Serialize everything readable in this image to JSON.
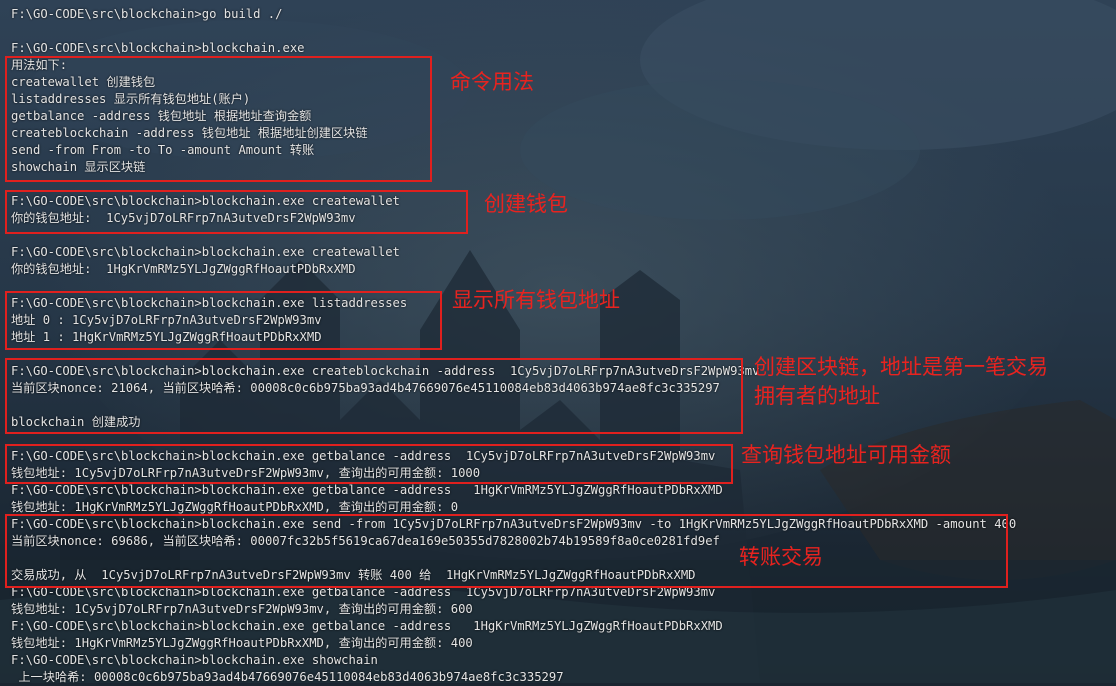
{
  "terminal": {
    "lines": [
      "F:\\GO-CODE\\src\\blockchain>go build ./",
      "",
      "F:\\GO-CODE\\src\\blockchain>blockchain.exe",
      "用法如下:",
      "createwallet 创建钱包",
      "listaddresses 显示所有钱包地址(账户)",
      "getbalance -address 钱包地址 根据地址查询金额",
      "createblockchain -address 钱包地址 根据地址创建区块链",
      "send -from From -to To -amount Amount 转账",
      "showchain 显示区块链",
      "",
      "F:\\GO-CODE\\src\\blockchain>blockchain.exe createwallet",
      "你的钱包地址:  1Cy5vjD7oLRFrp7nA3utveDrsF2WpW93mv",
      "",
      "F:\\GO-CODE\\src\\blockchain>blockchain.exe createwallet",
      "你的钱包地址:  1HgKrVmRMz5YLJgZWggRfHoautPDbRxXMD",
      "",
      "F:\\GO-CODE\\src\\blockchain>blockchain.exe listaddresses",
      "地址 0 : 1Cy5vjD7oLRFrp7nA3utveDrsF2WpW93mv",
      "地址 1 : 1HgKrVmRMz5YLJgZWggRfHoautPDbRxXMD",
      "",
      "F:\\GO-CODE\\src\\blockchain>blockchain.exe createblockchain -address  1Cy5vjD7oLRFrp7nA3utveDrsF2WpW93mv",
      "当前区块nonce: 21064, 当前区块哈希: 00008c0c6b975ba93ad4b47669076e45110084eb83d4063b974ae8fc3c335297",
      "",
      "blockchain 创建成功",
      "",
      "F:\\GO-CODE\\src\\blockchain>blockchain.exe getbalance -address  1Cy5vjD7oLRFrp7nA3utveDrsF2WpW93mv",
      "钱包地址: 1Cy5vjD7oLRFrp7nA3utveDrsF2WpW93mv, 查询出的可用金额: 1000",
      "F:\\GO-CODE\\src\\blockchain>blockchain.exe getbalance -address   1HgKrVmRMz5YLJgZWggRfHoautPDbRxXMD",
      "钱包地址: 1HgKrVmRMz5YLJgZWggRfHoautPDbRxXMD, 查询出的可用金额: 0",
      "F:\\GO-CODE\\src\\blockchain>blockchain.exe send -from 1Cy5vjD7oLRFrp7nA3utveDrsF2WpW93mv -to 1HgKrVmRMz5YLJgZWggRfHoautPDbRxXMD -amount 400",
      "当前区块nonce: 69686, 当前区块哈希: 00007fc32b5f5619ca67dea169e50355d7828002b74b19589f8a0ce0281fd9ef",
      "",
      "交易成功, 从  1Cy5vjD7oLRFrp7nA3utveDrsF2WpW93mv 转账 400 给  1HgKrVmRMz5YLJgZWggRfHoautPDbRxXMD",
      "F:\\GO-CODE\\src\\blockchain>blockchain.exe getbalance -address  1Cy5vjD7oLRFrp7nA3utveDrsF2WpW93mv",
      "钱包地址: 1Cy5vjD7oLRFrp7nA3utveDrsF2WpW93mv, 查询出的可用金额: 600",
      "F:\\GO-CODE\\src\\blockchain>blockchain.exe getbalance -address   1HgKrVmRMz5YLJgZWggRfHoautPDbRxXMD",
      "钱包地址: 1HgKrVmRMz5YLJgZWggRfHoautPDbRxXMD, 查询出的可用金额: 400",
      "F:\\GO-CODE\\src\\blockchain>blockchain.exe showchain",
      " 上一块哈希: 00008c0c6b975ba93ad4b47669076e45110084eb83d4063b974ae8fc3c335297"
    ]
  },
  "annotations": {
    "usage": "命令用法",
    "create_wallet": "创建钱包",
    "list_addresses": "显示所有钱包地址",
    "create_chain_1": "创建区块链，地址是第一笔交易",
    "create_chain_2": "拥有者的地址",
    "get_balance": "查询钱包地址可用金额",
    "transfer": "转账交易"
  },
  "colors": {
    "annotation": "#e8231f",
    "terminal_text": "#e4e4e4",
    "background": "#1b2530"
  }
}
